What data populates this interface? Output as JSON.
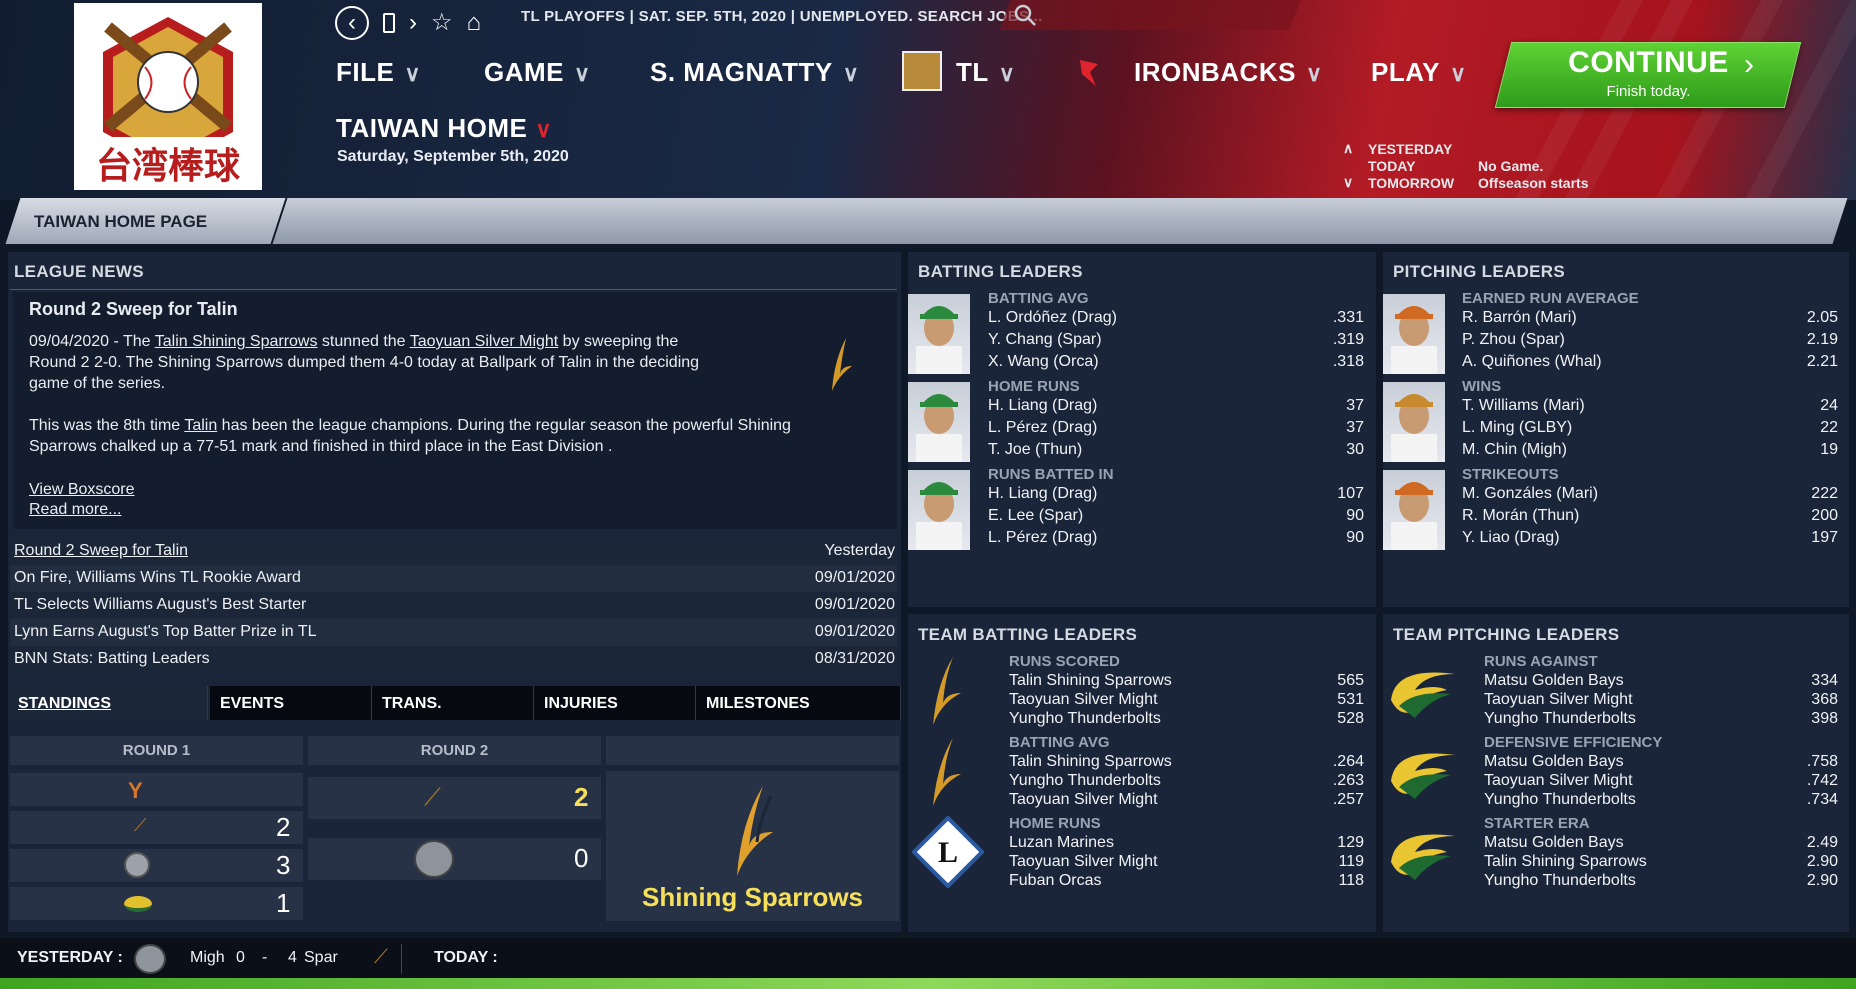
{
  "header": {
    "ticker": "TL PLAYOFFS  |  SAT. SEP. 5TH, 2020  |  UNEMPLOYED. SEARCH JOBS...",
    "logo_text": "台湾棒球",
    "menus": [
      "FILE",
      "GAME",
      "S. MAGNATTY",
      "TL",
      "IRONBACKS",
      "PLAY"
    ],
    "page_title": "TAIWAN  HOME",
    "date": "Saturday, September 5th, 2020",
    "continue_label": "CONTINUE",
    "continue_sub": "Finish today.",
    "days": {
      "yesterday": "YESTERDAY",
      "today": "TODAY",
      "tomorrow": "TOMORROW",
      "today_note": "No Game.",
      "tomorrow_note": "Offseason starts"
    }
  },
  "tabs": {
    "home": "TAIWAN  HOME PAGE"
  },
  "news": {
    "section_title": "LEAGUE NEWS",
    "headline": "Round 2 Sweep for Talin",
    "p1_date": "09/04/2020",
    "p1_a": " - The ",
    "p1_link1": "Talin Shining Sparrows",
    "p1_b": " stunned the ",
    "p1_link2": "Taoyuan Silver Might",
    "p1_c": " by sweeping the",
    "p1_line2": "Round 2 2-0. The Shining Sparrows dumped them 4-0 today at Ballpark of Talin in the deciding",
    "p1_line3": "game of the series.",
    "p2_a": "This was the 8th time ",
    "p2_link": "Talin",
    "p2_b": " has been the league champions. During the regular season the powerful Shining",
    "p2_line2": "Sparrows chalked up a 77-51 mark and finished in third place in the East Division .",
    "boxscore": "View Boxscore",
    "readmore": "Read more...",
    "list": [
      {
        "title": "Round 2 Sweep for Talin",
        "date": "Yesterday"
      },
      {
        "title": "On Fire, Williams Wins TL Rookie Award",
        "date": "09/01/2020"
      },
      {
        "title": "TL Selects Williams August's Best Starter",
        "date": "09/01/2020"
      },
      {
        "title": "Lynn Earns August's Top Batter Prize in TL",
        "date": "09/01/2020"
      },
      {
        "title": "BNN Stats: Batting Leaders",
        "date": "08/31/2020"
      }
    ]
  },
  "standings": {
    "tabs": [
      "STANDINGS",
      "EVENTS",
      "TRANS.",
      "INJURIES",
      "MILESTONES"
    ],
    "round1": "ROUND 1",
    "round2": "ROUND 2",
    "r1_scores": [
      "2",
      "3",
      "1"
    ],
    "r2_scores": [
      "2",
      "0"
    ],
    "champion": "Shining Sparrows"
  },
  "batting_leaders": {
    "title": "BATTING LEADERS",
    "groups": [
      {
        "label": "BATTING AVG",
        "rows": [
          [
            "L. Ordóñez (Drag)",
            ".331"
          ],
          [
            "Y. Chang (Spar)",
            ".319"
          ],
          [
            "X. Wang (Orca)",
            ".318"
          ]
        ]
      },
      {
        "label": "HOME RUNS",
        "rows": [
          [
            "H. Liang (Drag)",
            "37"
          ],
          [
            "L. Pérez (Drag)",
            "37"
          ],
          [
            "T. Joe (Thun)",
            "30"
          ]
        ]
      },
      {
        "label": "RUNS BATTED IN",
        "rows": [
          [
            "H. Liang (Drag)",
            "107"
          ],
          [
            "E. Lee (Spar)",
            "90"
          ],
          [
            "L. Pérez (Drag)",
            "90"
          ]
        ]
      }
    ]
  },
  "pitching_leaders": {
    "title": "PITCHING LEADERS",
    "groups": [
      {
        "label": "EARNED RUN AVERAGE",
        "rows": [
          [
            "R. Barrón (Mari)",
            "2.05"
          ],
          [
            "P. Zhou (Spar)",
            "2.19"
          ],
          [
            "A. Quiñones (Whal)",
            "2.21"
          ]
        ]
      },
      {
        "label": "WINS",
        "rows": [
          [
            "T. Williams (Mari)",
            "24"
          ],
          [
            "L. Ming (GLBY)",
            "22"
          ],
          [
            "M. Chin (Migh)",
            "19"
          ]
        ]
      },
      {
        "label": "STRIKEOUTS",
        "rows": [
          [
            "M. Gonzáles (Mari)",
            "222"
          ],
          [
            "R. Morán (Thun)",
            "200"
          ],
          [
            "Y. Liao (Drag)",
            "197"
          ]
        ]
      }
    ]
  },
  "team_batting": {
    "title": "TEAM BATTING LEADERS",
    "groups": [
      {
        "label": "RUNS SCORED",
        "rows": [
          [
            "Talin Shining Sparrows",
            "565"
          ],
          [
            "Taoyuan Silver Might",
            "531"
          ],
          [
            "Yungho Thunderbolts",
            "528"
          ]
        ]
      },
      {
        "label": "BATTING AVG",
        "rows": [
          [
            "Talin Shining Sparrows",
            ".264"
          ],
          [
            "Yungho Thunderbolts",
            ".263"
          ],
          [
            "Taoyuan Silver Might",
            ".257"
          ]
        ]
      },
      {
        "label": "HOME RUNS",
        "rows": [
          [
            "Luzan Marines",
            "129"
          ],
          [
            "Taoyuan Silver Might",
            "119"
          ],
          [
            "Fuban Orcas",
            "118"
          ]
        ]
      }
    ],
    "logo_letter": "L"
  },
  "team_pitching": {
    "title": "TEAM PITCHING LEADERS",
    "groups": [
      {
        "label": "RUNS AGAINST",
        "rows": [
          [
            "Matsu Golden Bays",
            "334"
          ],
          [
            "Taoyuan Silver Might",
            "368"
          ],
          [
            "Yungho Thunderbolts",
            "398"
          ]
        ]
      },
      {
        "label": "DEFENSIVE EFFICIENCY",
        "rows": [
          [
            "Matsu Golden Bays",
            ".758"
          ],
          [
            "Taoyuan Silver Might",
            ".742"
          ],
          [
            "Yungho Thunderbolts",
            ".734"
          ]
        ]
      },
      {
        "label": "STARTER ERA",
        "rows": [
          [
            "Matsu Golden Bays",
            "2.49"
          ],
          [
            "Talin Shining Sparrows",
            "2.90"
          ],
          [
            "Yungho Thunderbolts",
            "2.90"
          ]
        ]
      }
    ]
  },
  "footer": {
    "yesterday_label": "YESTERDAY :",
    "away": "Migh",
    "away_score": "0",
    "sep": "-",
    "home_score": "4",
    "home": "Spar",
    "today_label": "TODAY :"
  },
  "colors": {
    "accent_red": "#e0242e",
    "continue_green": "#3fb522",
    "highlight_yellow": "#f6e05a"
  }
}
